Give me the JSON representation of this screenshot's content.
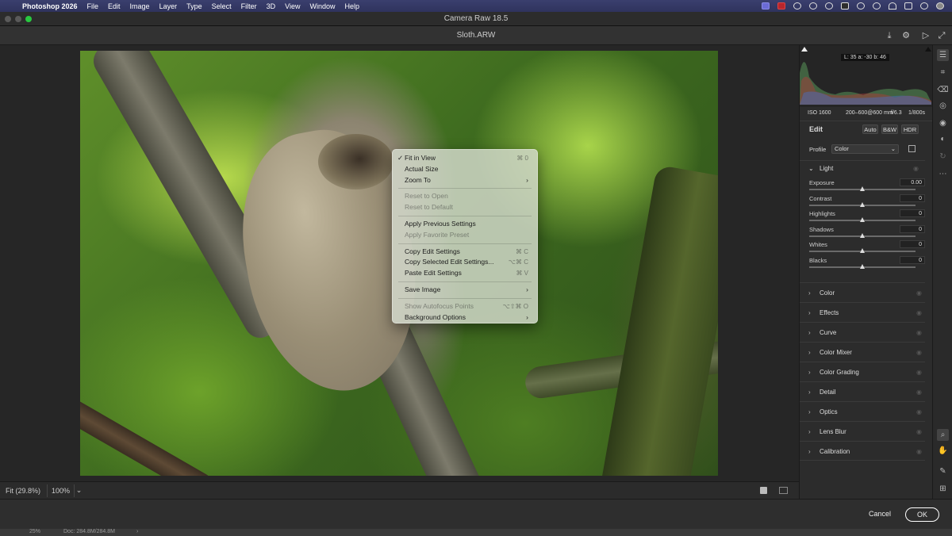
{
  "menubar": {
    "app_name": "Photoshop 2026",
    "items": [
      "File",
      "Edit",
      "Image",
      "Layer",
      "Type",
      "Select",
      "Filter",
      "3D",
      "View",
      "Window",
      "Help"
    ]
  },
  "window": {
    "title": "Camera Raw 18.5",
    "filename": "Sloth.ARW"
  },
  "context_menu": {
    "items": [
      {
        "label": "Fit in View",
        "shortcut": "⌘ 0",
        "checked": "✓"
      },
      {
        "label": "Actual Size",
        "shortcut": ""
      },
      {
        "label": "Zoom To",
        "shortcut": "›"
      },
      {
        "label": "Reset to Open",
        "shortcut": ""
      },
      {
        "label": "Reset to Default",
        "shortcut": ""
      },
      {
        "label": "Apply Previous Settings",
        "shortcut": ""
      },
      {
        "label": "Apply Favorite Preset",
        "shortcut": ""
      },
      {
        "label": "Copy Edit Settings",
        "shortcut": "⌘ C"
      },
      {
        "label": "Copy Selected Edit Settings...",
        "shortcut": "⌥⌘ C"
      },
      {
        "label": "Paste Edit Settings",
        "shortcut": "⌘ V"
      },
      {
        "label": "Save Image",
        "shortcut": "›"
      },
      {
        "label": "Show Autofocus Points",
        "shortcut": "⌥⇧⌘ O"
      },
      {
        "label": "Background Options",
        "shortcut": "›"
      }
    ]
  },
  "zoombar": {
    "fit_label": "Fit (29.8%)",
    "zoom_label": "100%",
    "caret": "⌄"
  },
  "footer": {
    "cancel_label": "Cancel",
    "ok_label": "OK"
  },
  "ps_status": {
    "zoom": "25%",
    "doc": "Doc: 284.8M/284.8M",
    "arrow": "›"
  },
  "histogram": {
    "lab": "L: 35   a: -30   b: 46",
    "iso": "ISO 1600",
    "lens": "200–600@600 mm",
    "aperture": "f/6.3",
    "shutter": "1/800s"
  },
  "edit_panel": {
    "title": "Edit",
    "auto_label": "Auto",
    "bw_label": "B&W",
    "hdr_label": "HDR",
    "profile_label": "Profile",
    "profile_value": "Color",
    "light_section": "Light",
    "sliders": [
      {
        "label": "Exposure",
        "value": "0.00",
        "level": 0.5
      },
      {
        "label": "Contrast",
        "value": "0",
        "level": 0.5
      },
      {
        "label": "Highlights",
        "value": "0",
        "level": 0.5
      },
      {
        "label": "Shadows",
        "value": "0",
        "level": 0.5
      },
      {
        "label": "Whites",
        "value": "0",
        "level": 0.5
      },
      {
        "label": "Blacks",
        "value": "0",
        "level": 0.5
      }
    ],
    "sections": [
      "Color",
      "Effects",
      "Curve",
      "Color Mixer",
      "Color Grading",
      "Detail",
      "Optics",
      "Lens Blur",
      "Calibration"
    ]
  },
  "icons": {
    "apple": "",
    "save": "⤓",
    "settings": "⚙",
    "present": "▷",
    "fullscreen": "⤢",
    "collapse_chevron": "›",
    "expand_chevron": "⌄",
    "eye": "◉",
    "check": "✓"
  },
  "colors": {
    "menubar": "#343864",
    "ok_border": "#ffffff",
    "red": "#ff5f57",
    "yellow": "#febc2e",
    "green": "#28c840"
  }
}
